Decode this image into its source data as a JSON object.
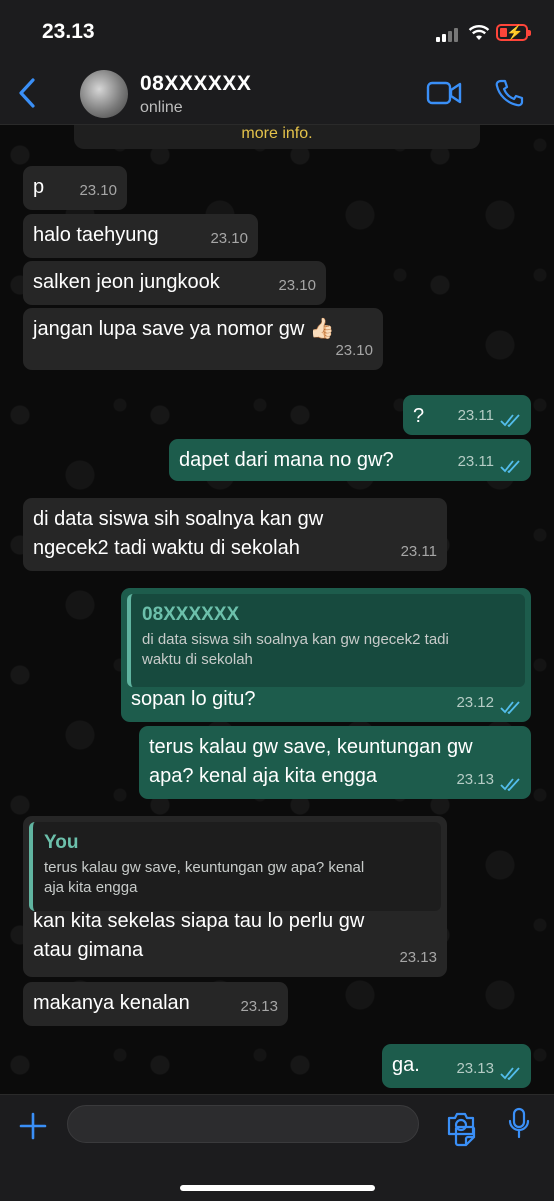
{
  "status_bar": {
    "time": "23.13"
  },
  "header": {
    "contact_name": "08XXXXXX",
    "contact_status": "online"
  },
  "chat": {
    "info_text": "more info.",
    "messages": [
      {
        "dir": "in",
        "text": "p",
        "time": "23.10"
      },
      {
        "dir": "in",
        "text": "halo taehyung",
        "time": "23.10"
      },
      {
        "dir": "in",
        "text": "salken jeon jungkook",
        "time": "23.10"
      },
      {
        "dir": "in",
        "text": "jangan lupa save ya nomor gw 👍🏻",
        "time": "23.10"
      },
      {
        "dir": "out",
        "text": "?",
        "time": "23.11",
        "status": "read"
      },
      {
        "dir": "out",
        "text": "dapet dari mana no gw?",
        "time": "23.11",
        "status": "read"
      },
      {
        "dir": "in",
        "text_lines": [
          "di data siswa sih soalnya kan gw",
          "ngecek2 tadi waktu di sekolah"
        ],
        "time": "23.11"
      },
      {
        "dir": "out",
        "quote_name": "08XXXXXX",
        "quote_lines": [
          "di data siswa sih soalnya kan gw ngecek2 tadi",
          "waktu di sekolah"
        ],
        "text": "sopan lo gitu?",
        "time": "23.12",
        "status": "read"
      },
      {
        "dir": "out",
        "text_lines": [
          "terus kalau gw save, keuntungan gw",
          "apa? kenal aja kita engga"
        ],
        "time": "23.13",
        "status": "read"
      },
      {
        "dir": "in",
        "quote_name": "You",
        "quote_lines": [
          "terus kalau gw save, keuntungan gw apa? kenal",
          "aja kita engga"
        ],
        "text_lines": [
          "kan kita sekelas siapa tau lo perlu gw",
          "atau gimana"
        ],
        "time": "23.13"
      },
      {
        "dir": "in",
        "text": "makanya kenalan",
        "time": "23.13"
      },
      {
        "dir": "out",
        "text": "ga.",
        "time": "23.13",
        "status": "read"
      }
    ]
  },
  "input_bar": {
    "placeholder": ""
  },
  "colors": {
    "incoming_bubble": "#262626",
    "outgoing_bubble": "#1d5c4c",
    "accent": "#3a8ff7",
    "read_ticks": "#53bdeb",
    "info_text": "#e4c24a"
  }
}
